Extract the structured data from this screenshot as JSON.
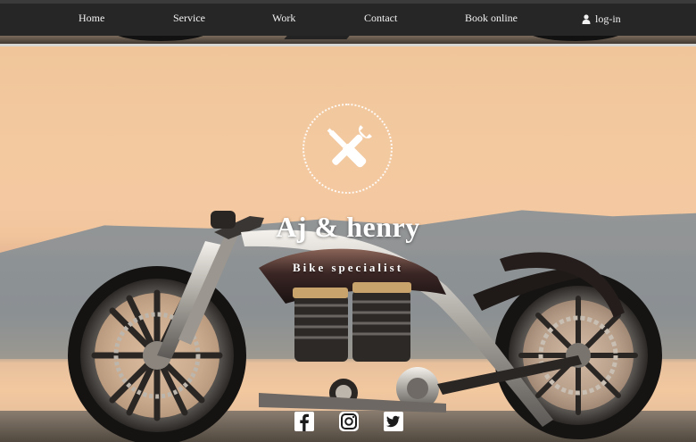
{
  "nav": {
    "items": [
      {
        "label": "Home"
      },
      {
        "label": "Service"
      },
      {
        "label": "Work"
      },
      {
        "label": "Contact"
      },
      {
        "label": "Book online"
      }
    ],
    "login_label": "log-in",
    "login_icon": "user-icon"
  },
  "hero": {
    "emblem_icon": "wrench-screwdriver-icon",
    "title": "Aj & henry",
    "subtitle": "Bike specialist"
  },
  "social": {
    "icons": [
      "facebook-icon",
      "instagram-icon",
      "twitter-icon"
    ]
  },
  "colors": {
    "nav_bg": "#262626",
    "text_light": "#ffffff",
    "sky": "#f3c9a0"
  }
}
